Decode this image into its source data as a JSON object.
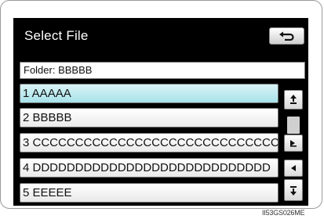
{
  "screen": {
    "title": "Select File",
    "folder_label": "Folder: BBBBB"
  },
  "files": [
    {
      "label": "1  AAAAA",
      "selected": true
    },
    {
      "label": "2  BBBBB",
      "selected": false
    },
    {
      "label": "3  CCCCCCCCCCCCCCCCCCCCCCCCCCCCC",
      "selected": false
    },
    {
      "label": "4  DDDDDDDDDDDDDDDDDDDDDDDDDDDD",
      "selected": false
    },
    {
      "label": "5  EEEEE",
      "selected": false
    }
  ],
  "icons": {
    "back": "return-arrow-icon",
    "page_up": "page-up-icon",
    "expand": "show-full-name-icon",
    "collapse": "collapse-name-icon",
    "page_down": "page-down-icon"
  },
  "scroll_position": 0,
  "caption": "II53GS026ME",
  "colors": {
    "screen_bg": "#000000",
    "selected_row": "#a7e2ea"
  }
}
